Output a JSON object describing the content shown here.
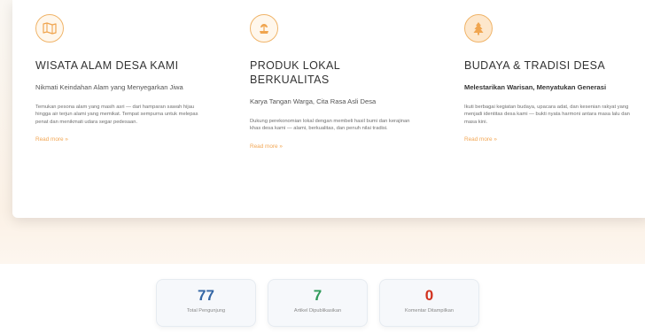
{
  "colors": {
    "accent": "#f0b469",
    "link": "#f2a755",
    "stat_blue": "#3466a5",
    "stat_green": "#2f9a5a",
    "stat_red": "#d2321f"
  },
  "cards": [
    {
      "icon": "map-icon",
      "title": "WISATA ALAM DESA KAMI",
      "subtitle": "Nikmati Keindahan Alam yang Menyegarkan Jiwa",
      "description": "Temukan pesona alam yang masih asri — dari hamparan sawah hijau hingga air terjun alami yang memikat. Tempat sempurna untuk melepas penat dan menikmati udara segar pedesaan.",
      "read_more": "Read more »"
    },
    {
      "icon": "plant-icon",
      "title": "PRODUK LOKAL BERKUALITAS",
      "subtitle": "Karya Tangan Warga, Cita Rasa Asli Desa",
      "description": "Dukung perekonomian lokal dengan membeli hasil bumi dan kerajinan khas desa kami — alami, berkualitas, dan penuh nilai tradisi.",
      "read_more": "Read more »"
    },
    {
      "icon": "tree-icon",
      "title": "BUDAYA & TRADISI DESA",
      "subtitle": "Melestarikan Warisan, Menyatukan Generasi",
      "description": "Ikuti berbagai kegiatan budaya, upacara adat, dan kesenian rakyat yang menjadi identitas desa kami — bukti nyata harmoni antara masa lalu dan masa kini.",
      "read_more": "Read more »"
    }
  ],
  "stats": [
    {
      "value": "77",
      "label": "Total Pengunjung"
    },
    {
      "value": "7",
      "label": "Artikel Dipublikasikan"
    },
    {
      "value": "0",
      "label": "Komentar Ditampilkan"
    }
  ]
}
